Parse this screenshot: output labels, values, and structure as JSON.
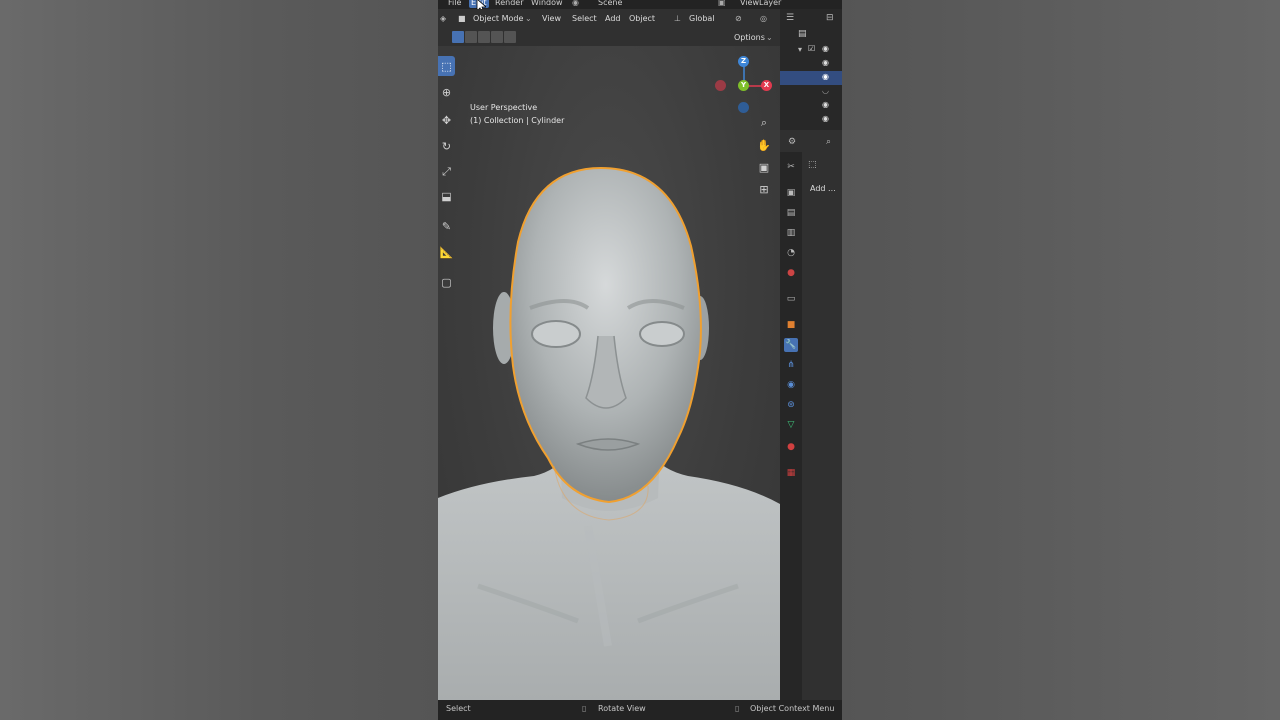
{
  "menu": {
    "file": "File",
    "edit": "Edit",
    "render": "Render",
    "window": "Window",
    "scene": "Scene",
    "view_layer": "ViewLayer"
  },
  "header": {
    "mode": "Object Mode",
    "view": "View",
    "select": "Select",
    "add": "Add",
    "object": "Object",
    "orientation": "Global",
    "options": "Options"
  },
  "viewport": {
    "perspective": "User Perspective",
    "collection": "(1) Collection | Cylinder"
  },
  "gizmo": {
    "x": "X",
    "y": "Y",
    "z": "Z"
  },
  "properties": {
    "add_modifier": "Add ..."
  },
  "status": {
    "select": "Select",
    "rotate": "Rotate View",
    "context": "Object Context Menu"
  },
  "colors": {
    "accent": "#4772b3",
    "selection_outline": "#f0a030",
    "axis_x": "#e23a4f",
    "axis_y": "#7fbf2a",
    "axis_z": "#3f86d6"
  }
}
